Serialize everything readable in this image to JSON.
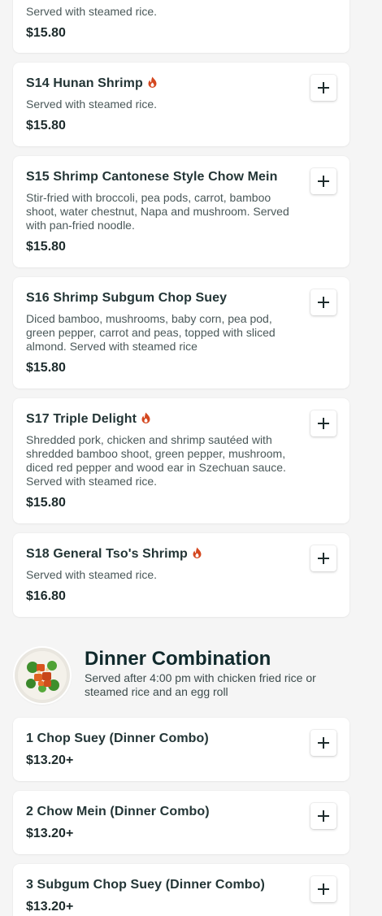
{
  "items_top": [
    {
      "desc": "Served with steamed rice.",
      "price": "$15.80"
    },
    {
      "title": "S14 Hunan Shrimp",
      "spicy": true,
      "desc": "Served with steamed rice.",
      "price": "$15.80"
    },
    {
      "title": "S15 Shrimp Cantonese Style Chow Mein",
      "spicy": false,
      "desc": "Stir-fried with broccoli, pea pods, carrot, bamboo shoot, water chestnut, Napa and mushroom. Served with pan-fried noodle.",
      "price": "$15.80"
    },
    {
      "title": "S16 Shrimp Subgum Chop Suey",
      "spicy": false,
      "desc": "Diced bamboo, mushrooms, baby corn, pea pod, green pepper, carrot and peas, topped with sliced almond. Served with steamed rice",
      "price": "$15.80"
    },
    {
      "title": "S17 Triple Delight",
      "spicy": true,
      "desc": "Shredded pork, chicken and shrimp sautéed with shredded bamboo shoot, green pepper, mushroom, diced red pepper and wood ear in Szechuan sauce. Served with steamed rice.",
      "price": "$15.80"
    },
    {
      "title": "S18 General Tso's Shrimp",
      "spicy": true,
      "desc": "Served with steamed rice.",
      "price": "$16.80"
    }
  ],
  "section": {
    "title": "Dinner Combination",
    "desc": "Served after 4:00 pm with chicken fried rice or steamed rice and an egg roll"
  },
  "combo_items": [
    {
      "title": "1 Chop Suey (Dinner Combo)",
      "price": "$13.20+"
    },
    {
      "title": "2 Chow Mein (Dinner Combo)",
      "price": "$13.20+"
    },
    {
      "title": "3 Subgum Chop Suey (Dinner Combo)",
      "price": "$13.20+"
    }
  ],
  "icons": {
    "add": "plus-icon",
    "spicy": "flame-icon"
  },
  "colors": {
    "spicy": "#d4471f",
    "text": "#1d2b2c"
  }
}
